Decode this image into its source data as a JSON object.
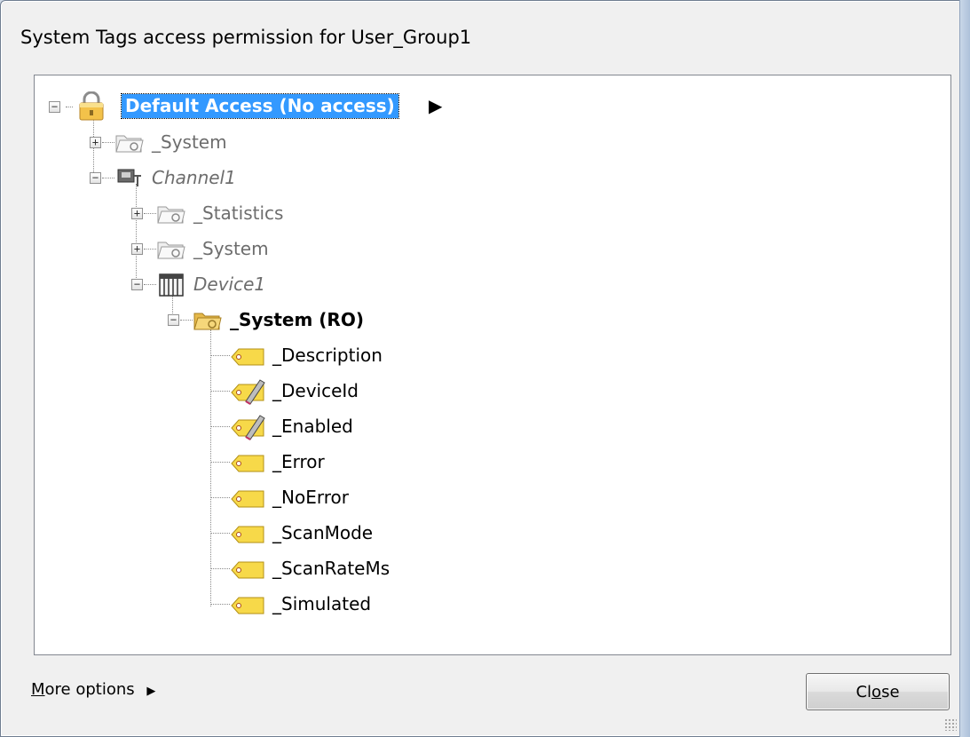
{
  "dialog": {
    "title": "System Tags access permission for User_Group1",
    "more_options_first": "M",
    "more_options_rest": "ore options",
    "more_options_arrow": "▶",
    "close_first": "Cl",
    "close_u": "o",
    "close_rest": "se"
  },
  "tree": {
    "root": {
      "label": "Default Access (No access)",
      "arrow": "▶",
      "icon": "lock-folder-icon"
    },
    "system_top": {
      "label": "_System",
      "icon": "folder-icon"
    },
    "channel": {
      "label": "Channel1",
      "icon": "channel-icon"
    },
    "statistics": {
      "label": "_Statistics",
      "icon": "folder-icon"
    },
    "channel_system": {
      "label": "_System",
      "icon": "folder-icon"
    },
    "device": {
      "label": "Device1",
      "icon": "device-icon"
    },
    "device_system": {
      "label": "_System (RO)",
      "icon": "open-folder-icon"
    },
    "tags": [
      {
        "label": "_Description",
        "icon": "tag-icon"
      },
      {
        "label": "_DeviceId",
        "icon": "tag-edit-icon"
      },
      {
        "label": "_Enabled",
        "icon": "tag-edit-icon"
      },
      {
        "label": "_Error",
        "icon": "tag-icon"
      },
      {
        "label": "_NoError",
        "icon": "tag-icon"
      },
      {
        "label": "_ScanMode",
        "icon": "tag-icon"
      },
      {
        "label": "_ScanRateMs",
        "icon": "tag-icon"
      },
      {
        "label": "_Simulated",
        "icon": "tag-icon"
      }
    ]
  },
  "colors": {
    "selection": "#3399ff",
    "folder": "#f5d36b",
    "tag": "#f7d949"
  }
}
